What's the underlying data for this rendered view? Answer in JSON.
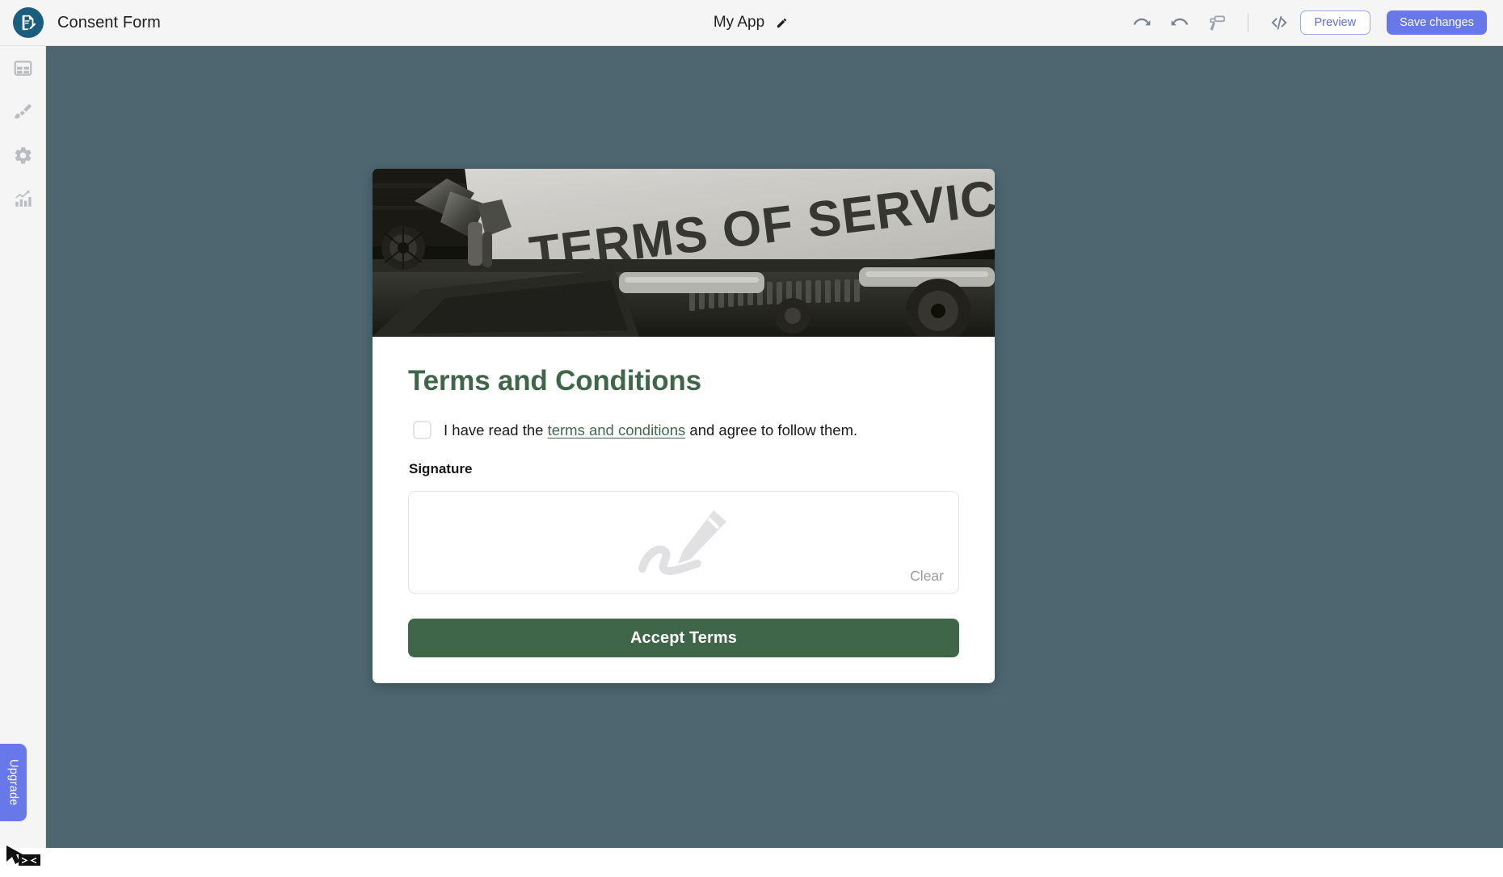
{
  "header": {
    "app_name": "Consent Form",
    "logo_icon": "document-pen-icon",
    "center_title": "My App",
    "edit_icon": "pencil-icon",
    "undo_icon": "undo-arrow-icon",
    "redo_icon": "redo-arrow-icon",
    "theme_icon": "paint-roller-icon",
    "code_icon": "code-brackets-icon",
    "preview_label": "Preview",
    "save_label": "Save changes",
    "accent_color": "#6878e8",
    "bar_color": "#f5f5f5"
  },
  "sidebar": {
    "items": [
      {
        "icon": "table-layout-icon",
        "name": "sidebar-item-layout"
      },
      {
        "icon": "paint-brush-icon",
        "name": "sidebar-item-theme"
      },
      {
        "icon": "gear-icon",
        "name": "sidebar-item-settings"
      },
      {
        "icon": "chart-bars-icon",
        "name": "sidebar-item-analytics"
      }
    ],
    "upgrade_label": "Upgrade",
    "upgrade_color": "#6878e8"
  },
  "canvas": {
    "background_color": "#4d6670"
  },
  "card": {
    "hero_image_alt": "TERMS OF SERVICE typed on paper in a typewriter",
    "hero_text": "TERMS OF SERVICE",
    "title": "Terms and Conditions",
    "title_color": "#3e6647",
    "consent": {
      "checked": false,
      "text_before": "I have read the ",
      "link_text": "terms and conditions",
      "text_after": " and agree to follow them."
    },
    "signature": {
      "label": "Signature",
      "value": "",
      "placeholder_icon": "signature-pen-icon",
      "clear_label": "Clear"
    },
    "submit_label": "Accept Terms",
    "submit_color": "#3f6648"
  }
}
